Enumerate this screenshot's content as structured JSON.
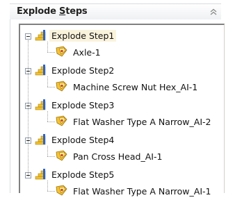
{
  "header": {
    "title": "Explode Steps",
    "collapse_icon": "chevron-up-icon"
  },
  "tree": {
    "steps": [
      {
        "label": "Explode Step1",
        "child": "Axle-1",
        "selected": true
      },
      {
        "label": "Explode Step2",
        "child": "Machine Screw Nut Hex_AI-1"
      },
      {
        "label": "Explode Step3",
        "child": "Flat Washer Type A Narrow_AI-2"
      },
      {
        "label": "Explode Step4",
        "child": "Pan Cross Head_AI-1"
      },
      {
        "label": "Explode Step5",
        "child": "Flat Washer Type A Narrow_AI-1"
      }
    ]
  },
  "colors": {
    "step_icon_yellow": "#f2c12e",
    "step_icon_blue": "#2f63c9",
    "part_icon_yellow": "#f6c431",
    "selection_bg": "#faf3dc"
  }
}
